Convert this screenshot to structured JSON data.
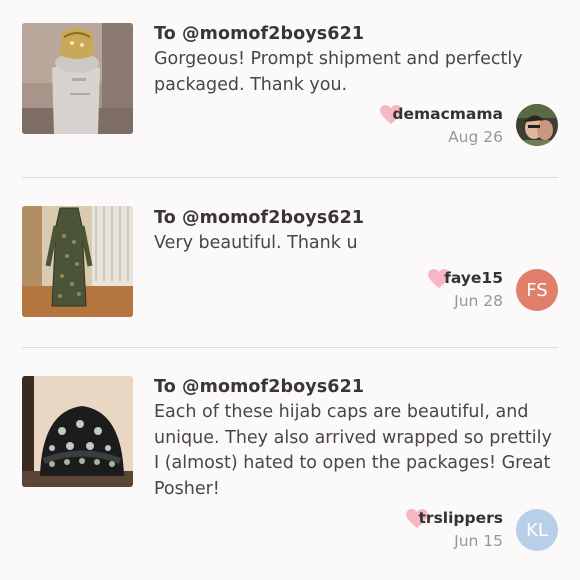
{
  "reviews": [
    {
      "to": "To @momof2boys621",
      "message": "Gorgeous! Prompt shipment and perfectly packaged. Thank you.",
      "username": "demacmama",
      "date": "Aug 26",
      "avatar_type": "photo",
      "thumb_desc": "hat-on-mannequin"
    },
    {
      "to": "To @momof2boys621",
      "message": "Very beautiful. Thank u",
      "username": "faye15",
      "date": "Jun 28",
      "avatar_initials": "FS",
      "avatar_color": "#e07f6a",
      "thumb_desc": "long-dress"
    },
    {
      "to": "To @momof2boys621",
      "message": "Each of these hijab caps are beautiful, and unique. They also arrived wrapped so prettily I (almost) hated to open the packages! Great Posher!",
      "username": "trslippers",
      "date": "Jun 15",
      "avatar_initials": "KL",
      "avatar_color": "#b8cfe9",
      "thumb_desc": "jeweled-cap"
    }
  ],
  "colors": {
    "heart": "#f7b6c3",
    "divider": "#dddada",
    "background": "#fbf9f9"
  }
}
